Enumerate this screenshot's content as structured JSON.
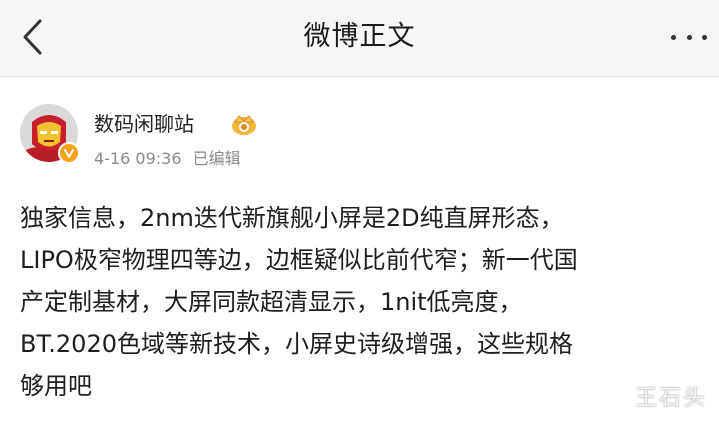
{
  "nav": {
    "title": "微博正文",
    "back_icon": "chevron-left-icon",
    "more_icon": "more-horizontal-icon"
  },
  "author": {
    "name": "数码闲聊站",
    "avatar_icon": "iron-man-avatar",
    "verified_icon": "verified-v-icon",
    "level_icon": "crown-badge-icon",
    "timestamp": "4-16 09:36",
    "edited_label": "已编辑"
  },
  "post": {
    "text_lines": [
      "独家信息，2nm迭代新旗舰小屏是2D纯直屏形态，",
      "LIPO极窄物理四等边，边框疑似比前代窄；新一代国",
      "产定制基材，大屏同款超清显示，1nit低亮度，",
      "BT.2020色域等新技术，小屏史诗级增强，这些规格",
      "够用吧"
    ]
  },
  "watermark": "王石头",
  "colors": {
    "nav_bg": "#f6f6f6",
    "text": "#1e1e1e",
    "meta": "#8a8a8a",
    "verified": "#f7a21b"
  }
}
